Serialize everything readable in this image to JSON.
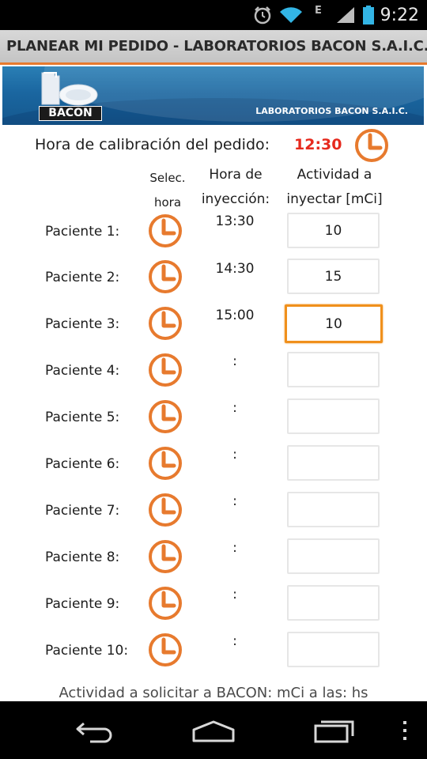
{
  "status_bar": {
    "time": "9:22",
    "network_type": "E",
    "icons": [
      "alarm-icon",
      "wifi-icon",
      "signal-icon",
      "battery-icon"
    ]
  },
  "app": {
    "title": "PLANEAR MI PEDIDO - LABORATORIOS BACON S.A.I.C.",
    "banner_logo_text": "BACON",
    "banner_company": "LABORATORIOS BACON S.A.I.C."
  },
  "calibration": {
    "label": "Hora de calibración del pedido:",
    "time": "12:30"
  },
  "headers": {
    "select_line1": "Selec.",
    "select_line2": "hora",
    "injection_line1": "Hora de",
    "injection_line2": "inyección:",
    "activity_line1": "Actividad a",
    "activity_line2": "inyectar [mCi]"
  },
  "patients": [
    {
      "label": "Paciente 1:",
      "time": "13:30",
      "activity": "10"
    },
    {
      "label": "Paciente 2:",
      "time": "14:30",
      "activity": "15"
    },
    {
      "label": "Paciente 3:",
      "time": "15:00",
      "activity": "10"
    },
    {
      "label": "Paciente 4:",
      "time": ":",
      "activity": ""
    },
    {
      "label": "Paciente 5:",
      "time": ":",
      "activity": ""
    },
    {
      "label": "Paciente 6:",
      "time": ":",
      "activity": ""
    },
    {
      "label": "Paciente 7:",
      "time": ":",
      "activity": ""
    },
    {
      "label": "Paciente 8:",
      "time": ":",
      "activity": ""
    },
    {
      "label": "Paciente 9:",
      "time": ":",
      "activity": ""
    },
    {
      "label": "Paciente 10:",
      "time": ":",
      "activity": ""
    }
  ],
  "footer": {
    "text": "Actividad a solicitar a BACON:  mCi a las:  hs"
  },
  "colors": {
    "accent_orange": "#e77a2e",
    "calibration_red": "#e62a1e",
    "banner_blue": "#1a66a0"
  },
  "nav": {
    "icons": [
      "back-icon",
      "home-icon",
      "recent-apps-icon",
      "menu-icon"
    ]
  }
}
